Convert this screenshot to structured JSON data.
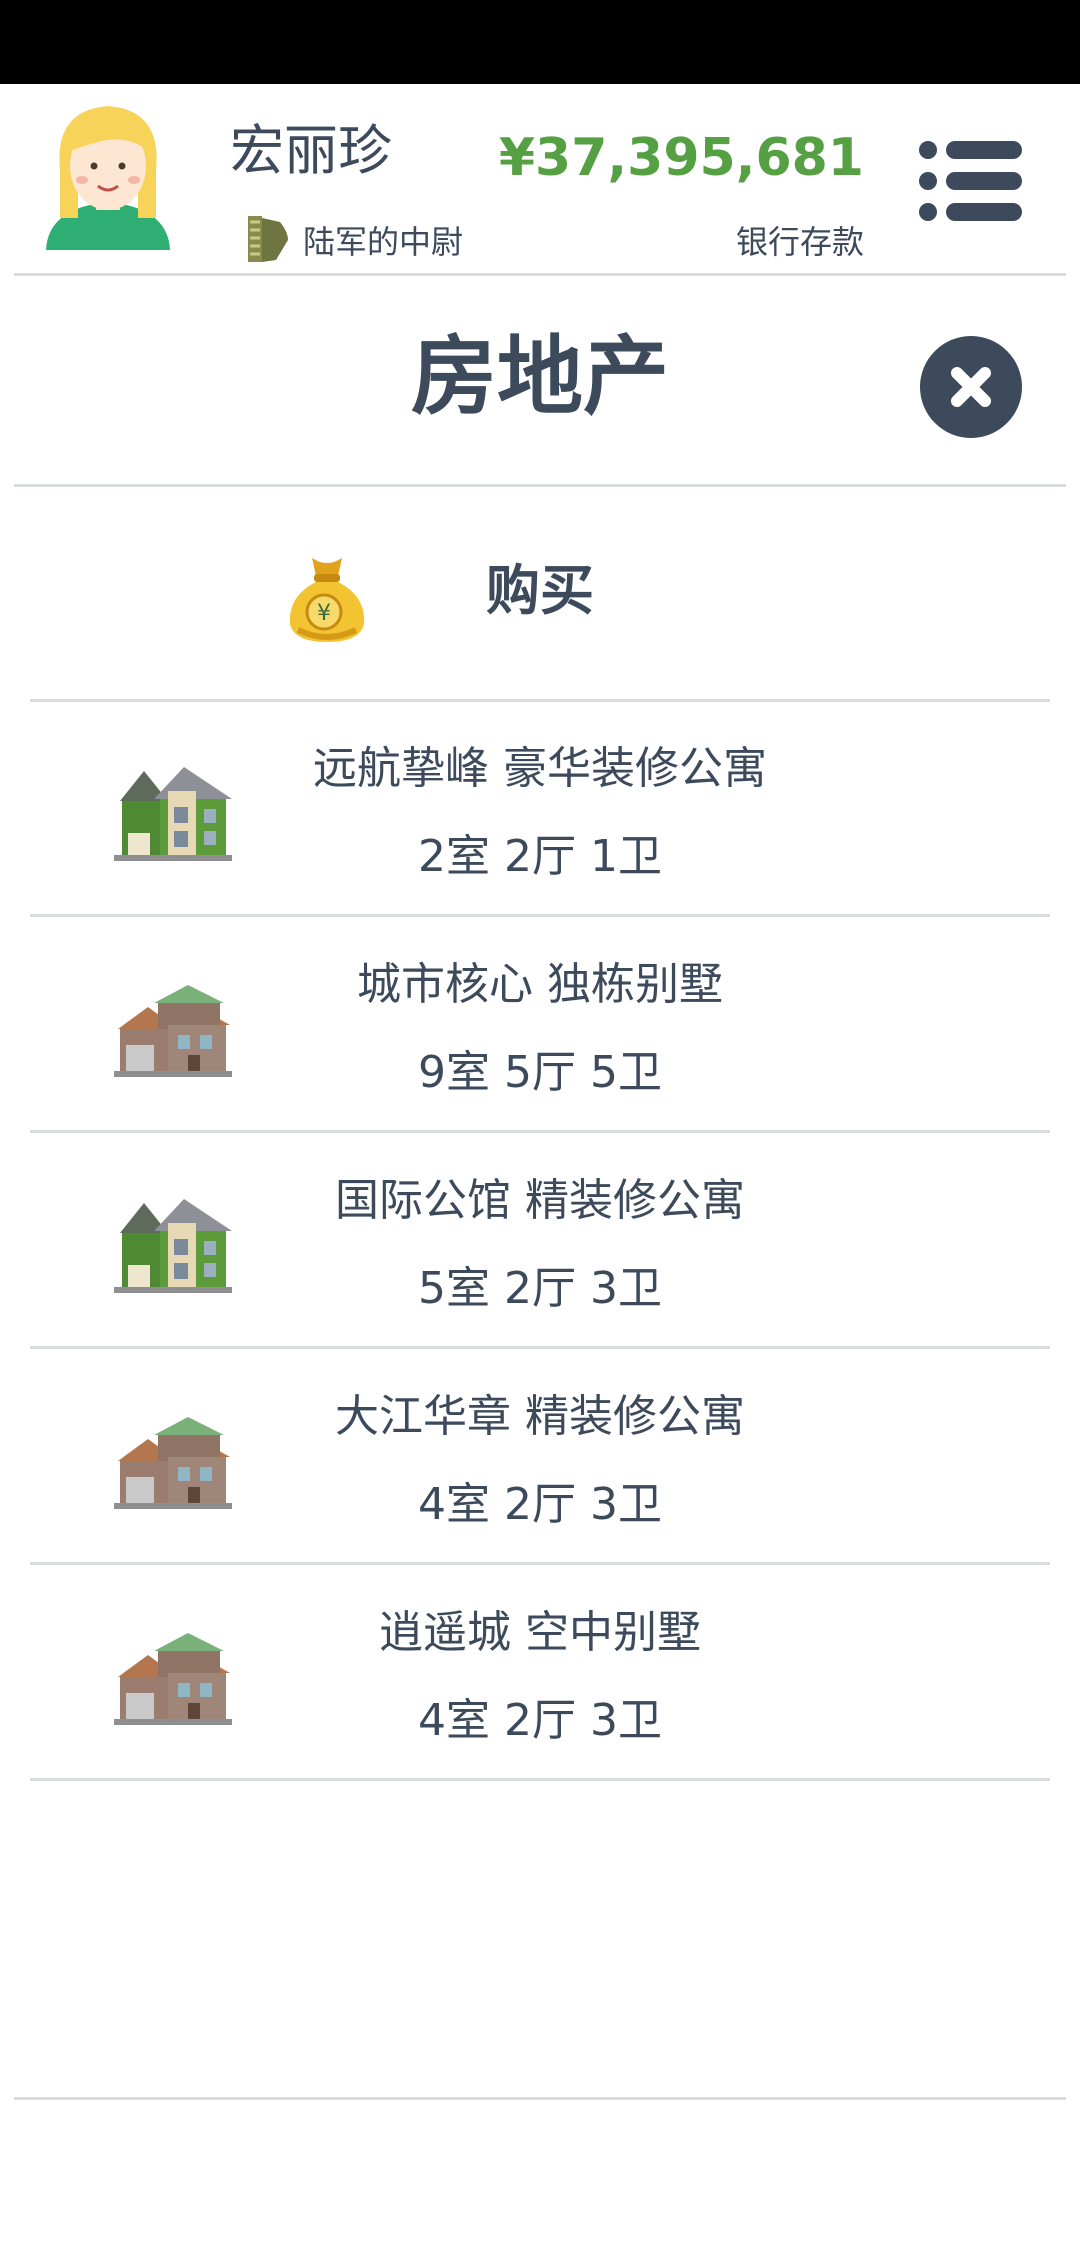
{
  "player": {
    "name": "宏丽珍",
    "rank": "陆军的中尉",
    "balance": "¥37,395,681",
    "balance_label": "银行存款"
  },
  "page": {
    "title": "房地产"
  },
  "buy": {
    "label": "购买",
    "icon": "money-bag-yuan-icon"
  },
  "properties": [
    {
      "name": "远航挚峰 豪华装修公寓",
      "rooms": "2室 2厅 1卫",
      "icon": "green-house-icon"
    },
    {
      "name": "城市核心 独栋别墅",
      "rooms": "9室 5厅 5卫",
      "icon": "brown-villa-icon"
    },
    {
      "name": "国际公馆 精装修公寓",
      "rooms": "5室 2厅 3卫",
      "icon": "green-house-icon"
    },
    {
      "name": "大江华章 精装修公寓",
      "rooms": "4室 2厅 3卫",
      "icon": "brown-villa-icon"
    },
    {
      "name": "逍遥城 空中别墅",
      "rooms": "4室 2厅 3卫",
      "icon": "brown-villa-icon"
    }
  ],
  "colors": {
    "text": "#3c4a5c",
    "balance": "#56a044",
    "divider": "#d8dbdf"
  }
}
